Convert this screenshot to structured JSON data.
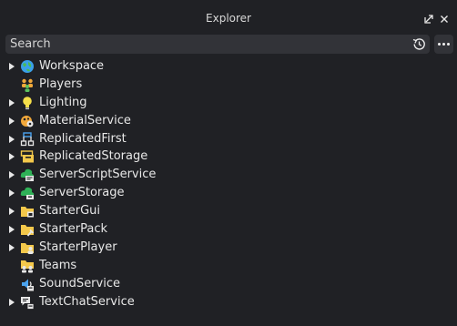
{
  "panel": {
    "title": "Explorer",
    "dock_icon": "undock-icon",
    "close_icon": "close-icon"
  },
  "search": {
    "placeholder": "Search",
    "value": "",
    "history_icon": "history-icon",
    "more_icon": "more-options-icon"
  },
  "tree": {
    "items": [
      {
        "label": "Workspace",
        "icon": "workspace-icon",
        "expandable": true
      },
      {
        "label": "Players",
        "icon": "players-icon",
        "expandable": false
      },
      {
        "label": "Lighting",
        "icon": "lighting-icon",
        "expandable": true
      },
      {
        "label": "MaterialService",
        "icon": "material-service-icon",
        "expandable": true
      },
      {
        "label": "ReplicatedFirst",
        "icon": "replicated-first-icon",
        "expandable": true
      },
      {
        "label": "ReplicatedStorage",
        "icon": "replicated-storage-icon",
        "expandable": true
      },
      {
        "label": "ServerScriptService",
        "icon": "server-script-service-icon",
        "expandable": true
      },
      {
        "label": "ServerStorage",
        "icon": "server-storage-icon",
        "expandable": true
      },
      {
        "label": "StarterGui",
        "icon": "starter-gui-icon",
        "expandable": true
      },
      {
        "label": "StarterPack",
        "icon": "starter-pack-icon",
        "expandable": true
      },
      {
        "label": "StarterPlayer",
        "icon": "starter-player-icon",
        "expandable": true
      },
      {
        "label": "Teams",
        "icon": "teams-icon",
        "expandable": false
      },
      {
        "label": "SoundService",
        "icon": "sound-service-icon",
        "expandable": false
      },
      {
        "label": "TextChatService",
        "icon": "text-chat-service-icon",
        "expandable": true
      }
    ]
  },
  "colors": {
    "background": "#202125",
    "field": "#323338",
    "text": "#e8e8e8",
    "folder": "#f3c84b",
    "green": "#2fb157"
  }
}
